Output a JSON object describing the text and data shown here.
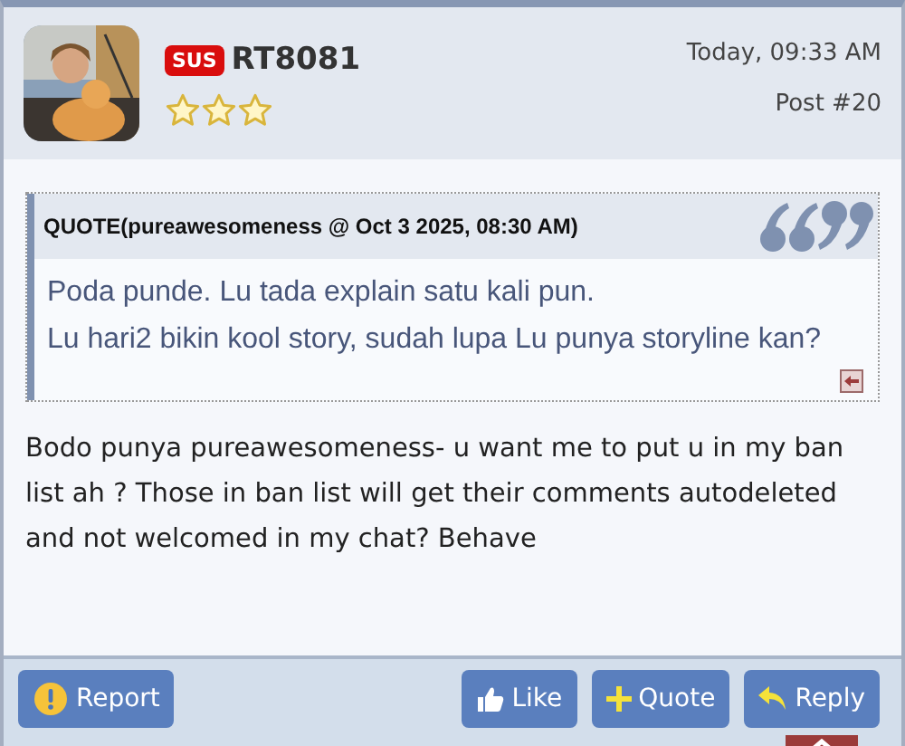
{
  "post": {
    "badge": "SUS",
    "username": "RT8081",
    "stars": 3,
    "date": "Today, 09:33 AM",
    "post_number": "Post #20"
  },
  "quote": {
    "header": "QUOTE(pureawesomeness @ Oct 3 2025, 08:30 AM)",
    "lines": [
      "Poda punde. Lu tada explain satu kali pun.",
      "Lu hari2 bikin kool story, sudah lupa Lu punya storyline kan?"
    ]
  },
  "body": "Bodo punya pureawesomeness- u want me to put u in my ban list ah ? Those in ban list will get their comments autodeleted and not welcomed in my chat? Behave",
  "buttons": [
    {
      "kind": "report",
      "label": "Report"
    },
    {
      "kind": "like",
      "label": "Like"
    },
    {
      "kind": "quote",
      "label": "Quote"
    },
    {
      "kind": "reply",
      "label": "Reply"
    }
  ]
}
